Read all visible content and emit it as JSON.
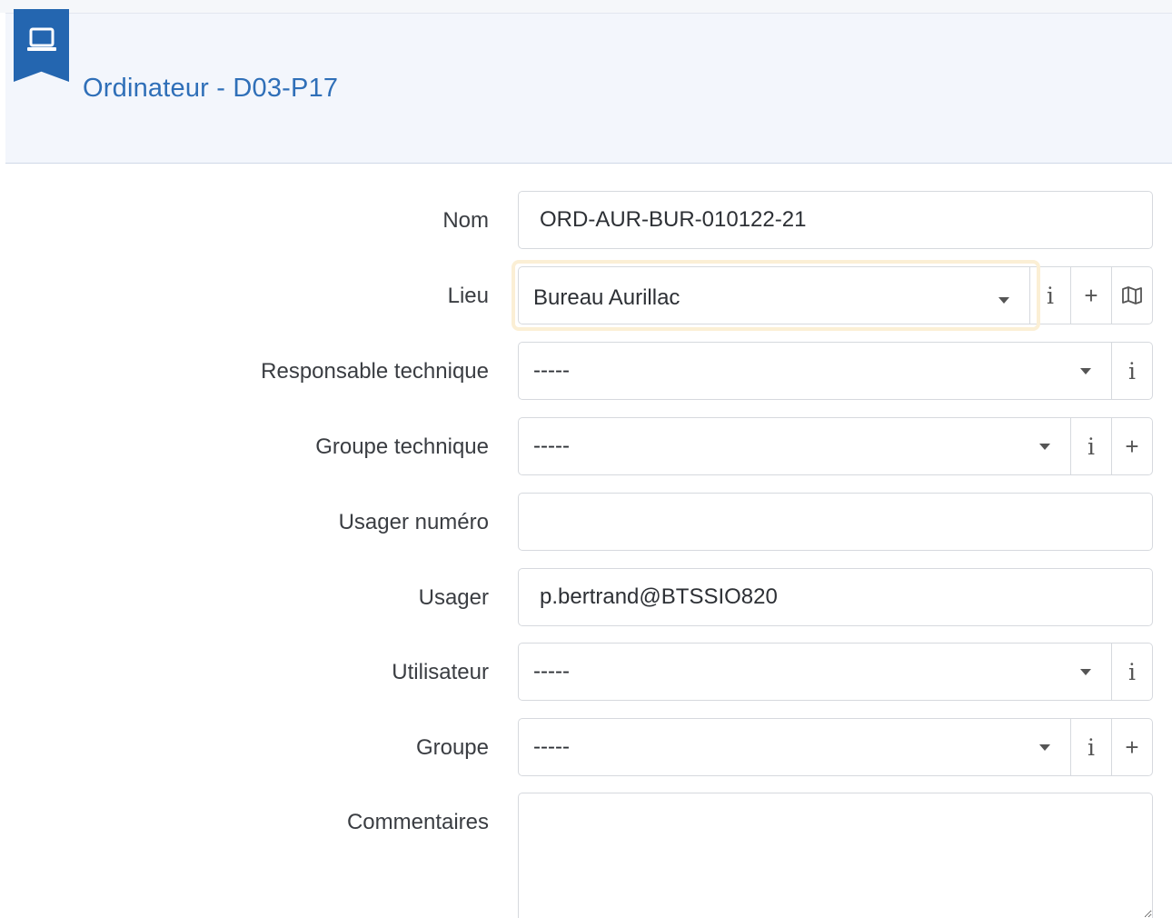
{
  "header": {
    "title": "Ordinateur - D03-P17",
    "icon": "laptop-icon",
    "accent": "#2466b0"
  },
  "form": {
    "nom": {
      "label": "Nom",
      "value": "ORD-AUR-BUR-010122-21"
    },
    "lieu": {
      "label": "Lieu",
      "value": "Bureau Aurillac",
      "addons": [
        "i",
        "+",
        "map-icon"
      ]
    },
    "responsable_technique": {
      "label": "Responsable technique",
      "value": "-----",
      "addons": [
        "i"
      ]
    },
    "groupe_technique": {
      "label": "Groupe technique",
      "value": "-----",
      "addons": [
        "i",
        "+"
      ]
    },
    "usager_numero": {
      "label": "Usager numéro",
      "value": ""
    },
    "usager": {
      "label": "Usager",
      "value": "p.bertrand@BTSSIO820"
    },
    "utilisateur": {
      "label": "Utilisateur",
      "value": "-----",
      "addons": [
        "i"
      ]
    },
    "groupe": {
      "label": "Groupe",
      "value": "-----",
      "addons": [
        "i",
        "+"
      ]
    },
    "commentaires": {
      "label": "Commentaires",
      "value": ""
    }
  }
}
